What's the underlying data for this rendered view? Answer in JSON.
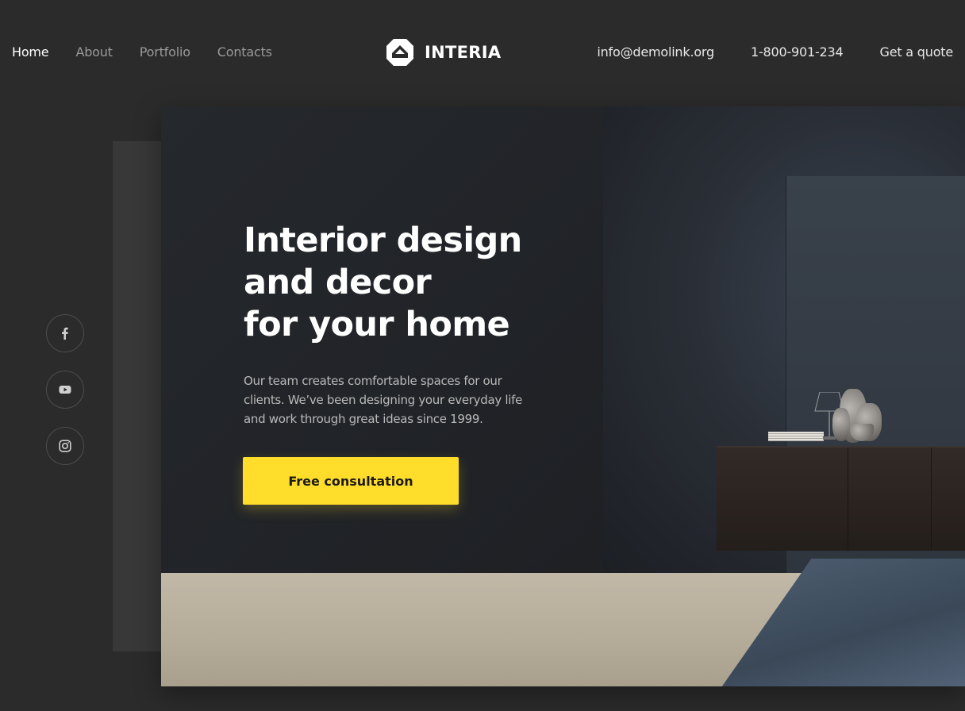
{
  "nav": {
    "items": [
      {
        "label": "Home",
        "active": true
      },
      {
        "label": "About",
        "active": false
      },
      {
        "label": "Portfolio",
        "active": false
      },
      {
        "label": "Contacts",
        "active": false
      }
    ]
  },
  "brand": {
    "name": "INTERIA",
    "icon": "interia-logo-icon"
  },
  "header": {
    "email": "info@demolink.org",
    "phone": "1-800-901-234",
    "quote_label": "Get a quote"
  },
  "social": [
    {
      "icon": "facebook-icon"
    },
    {
      "icon": "youtube-icon"
    },
    {
      "icon": "instagram-icon"
    }
  ],
  "hero": {
    "title_lines": [
      "Interior design",
      "and decor",
      "for your home"
    ],
    "description": "Our team creates comfortable spaces for our clients. We’ve been designing your everyday life and work through great ideas since 1999.",
    "cta_label": "Free consultation"
  },
  "colors": {
    "background": "#2b2b2b",
    "accent": "#ffdd2a",
    "text_primary": "#ffffff",
    "text_muted": "#9a9a9a"
  }
}
